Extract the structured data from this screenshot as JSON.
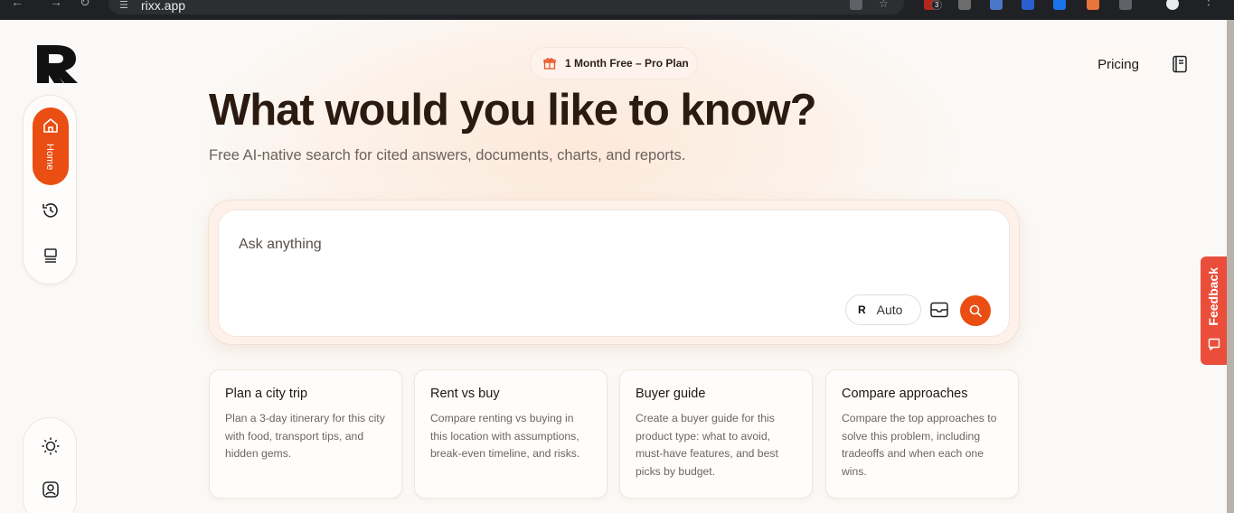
{
  "browser": {
    "url": "rixx.app",
    "extension_badge": "3"
  },
  "brand": {
    "logo_icon": "rixx-logo-icon"
  },
  "sidebar": {
    "home_label": "Home",
    "items": [
      {
        "icon": "home-icon"
      },
      {
        "icon": "history-icon"
      },
      {
        "icon": "library-icon"
      }
    ],
    "bottom": [
      {
        "icon": "sun-icon"
      },
      {
        "icon": "user-icon"
      }
    ]
  },
  "header": {
    "promo": "1 Month Free – Pro Plan",
    "pricing": "Pricing"
  },
  "hero": {
    "title": "What would you like to know?",
    "subtitle": "Free AI-native search for cited answers, documents, charts, and reports."
  },
  "search": {
    "placeholder": "Ask anything",
    "value": "",
    "mode_label": "Auto"
  },
  "cards": [
    {
      "title": "Plan a city trip",
      "desc": "Plan a 3-day itinerary for this city with food, transport tips, and hidden gems."
    },
    {
      "title": "Rent vs buy",
      "desc": "Compare renting vs buying in this location with assumptions, break-even timeline, and risks."
    },
    {
      "title": "Buyer guide",
      "desc": "Create a buyer guide for this product type: what to avoid, must-have features, and best picks by budget."
    },
    {
      "title": "Compare approaches",
      "desc": "Compare the top approaches to solve this problem, including tradeoffs and when each one wins."
    }
  ],
  "feedback": {
    "label": "Feedback"
  },
  "colors": {
    "accent": "#ea4e12",
    "feedback": "#ea4e3a"
  }
}
